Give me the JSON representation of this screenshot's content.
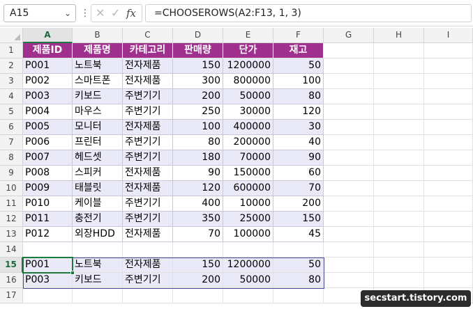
{
  "name_box": {
    "value": "A15"
  },
  "formula_bar": {
    "formula": "=CHOOSEROWS(A2:F13, 1, 3)"
  },
  "columns": [
    "A",
    "B",
    "C",
    "D",
    "E",
    "F",
    "G",
    "H",
    "I"
  ],
  "rows": [
    "1",
    "2",
    "3",
    "4",
    "5",
    "6",
    "7",
    "8",
    "9",
    "10",
    "11",
    "12",
    "13",
    "14",
    "15",
    "16",
    "17"
  ],
  "table": {
    "headers": [
      "제품ID",
      "제품명",
      "카테고리",
      "판매량",
      "단가",
      "재고"
    ],
    "rows": [
      [
        "P001",
        "노트북",
        "전자제품",
        "150",
        "1200000",
        "50"
      ],
      [
        "P002",
        "스마트폰",
        "전자제품",
        "300",
        "800000",
        "100"
      ],
      [
        "P003",
        "키보드",
        "주변기기",
        "200",
        "50000",
        "80"
      ],
      [
        "P004",
        "마우스",
        "주변기기",
        "250",
        "30000",
        "120"
      ],
      [
        "P005",
        "모니터",
        "전자제품",
        "100",
        "400000",
        "30"
      ],
      [
        "P006",
        "프린터",
        "주변기기",
        "80",
        "200000",
        "40"
      ],
      [
        "P007",
        "헤드셋",
        "주변기기",
        "180",
        "70000",
        "90"
      ],
      [
        "P008",
        "스피커",
        "전자제품",
        "90",
        "150000",
        "60"
      ],
      [
        "P009",
        "태블릿",
        "전자제품",
        "120",
        "600000",
        "70"
      ],
      [
        "P010",
        "케이블",
        "주변기기",
        "400",
        "10000",
        "200"
      ],
      [
        "P011",
        "충전기",
        "주변기기",
        "350",
        "25000",
        "150"
      ],
      [
        "P012",
        "외장HDD",
        "전자제품",
        "70",
        "100000",
        "45"
      ]
    ]
  },
  "result": {
    "rows": [
      [
        "P001",
        "노트북",
        "전자제품",
        "150",
        "1200000",
        "50"
      ],
      [
        "P003",
        "키보드",
        "주변기기",
        "200",
        "50000",
        "80"
      ]
    ]
  },
  "watermark": "secstart.tistory.com",
  "icons": {
    "cancel": "x-icon",
    "confirm": "check-icon",
    "function": "fx-icon",
    "namebox_dropdown": "chevron-down-icon"
  },
  "colors": {
    "header_fill": "#a0308e",
    "band_fill": "#e9e9f8",
    "selection": "#1b7a3e"
  }
}
